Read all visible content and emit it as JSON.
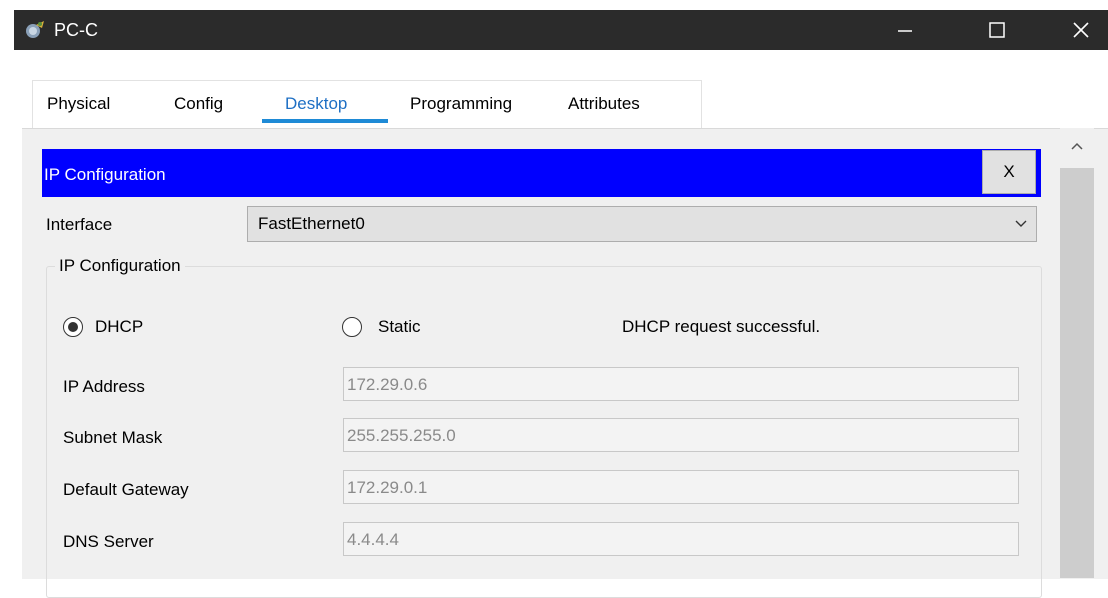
{
  "window": {
    "title": "PC-C",
    "icon": "packet-tracer-pc-icon",
    "controls": {
      "minimize": "—",
      "maximize": "☐",
      "close": "✕"
    }
  },
  "tabs": [
    {
      "label": "Physical",
      "active": false
    },
    {
      "label": "Config",
      "active": false
    },
    {
      "label": "Desktop",
      "active": true
    },
    {
      "label": "Programming",
      "active": false
    },
    {
      "label": "Attributes",
      "active": false
    }
  ],
  "panel": {
    "header": "IP Configuration",
    "close_label": "X",
    "interface_label": "Interface",
    "interface_value": "FastEthernet0",
    "section_label": "IP Configuration",
    "dhcp_label": "DHCP",
    "static_label": "Static",
    "mode": "DHCP",
    "status": "DHCP request successful.",
    "fields": [
      {
        "label": "IP Address",
        "value": "172.29.0.6"
      },
      {
        "label": "Subnet Mask",
        "value": "255.255.255.0"
      },
      {
        "label": "Default Gateway",
        "value": "172.29.0.1"
      },
      {
        "label": "DNS Server",
        "value": "4.4.4.4"
      }
    ]
  },
  "colors": {
    "header_bg": "#0000ff",
    "titlebar_bg": "#2b2b2b",
    "active_tab_accent": "#1e8ad6"
  }
}
